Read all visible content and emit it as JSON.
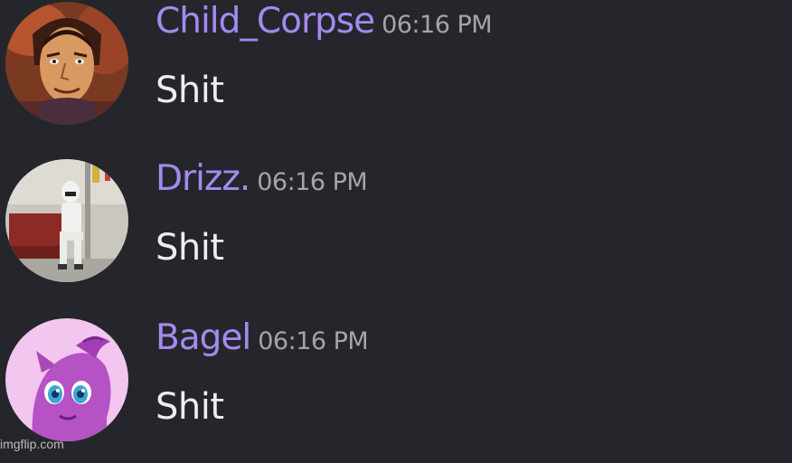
{
  "messages": [
    {
      "username": "Child_Corpse",
      "timestamp": "06:16 PM",
      "content": "Shit",
      "avatar_icon": "cartoon-man-avatar"
    },
    {
      "username": "Drizz.",
      "timestamp": "06:16 PM",
      "content": "Shit",
      "avatar_icon": "stormtrooper-photo-avatar"
    },
    {
      "username": "Bagel",
      "timestamp": "06:16 PM",
      "content": "Shit",
      "avatar_icon": "purple-pony-avatar"
    }
  ],
  "watermark": "imgflip.com",
  "colors": {
    "background": "#25262b",
    "username": "#a48af0",
    "timestamp": "#a2a5ac",
    "message_text": "#eceef0"
  }
}
